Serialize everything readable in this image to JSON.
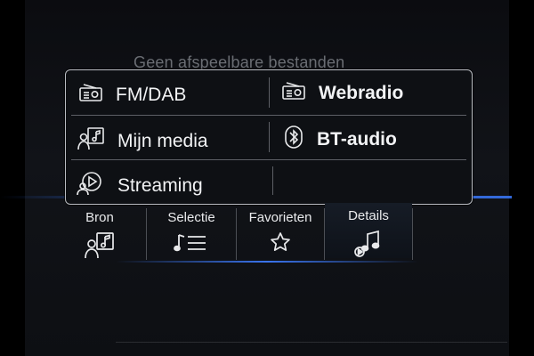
{
  "background_text": "Geen afspeelbare bestanden",
  "source_menu": {
    "items": [
      {
        "label": "FM/DAB",
        "icon": "radio-icon"
      },
      {
        "label": "Webradio",
        "icon": "webradio-icon"
      },
      {
        "label": "Mijn media",
        "icon": "my-media-icon"
      },
      {
        "label": "BT-audio",
        "icon": "bluetooth-icon"
      },
      {
        "label": "Streaming",
        "icon": "streaming-icon"
      },
      {
        "label": "",
        "icon": ""
      }
    ]
  },
  "tabs": [
    {
      "label": "Bron",
      "icon": "source-icon",
      "active": false
    },
    {
      "label": "Selectie",
      "icon": "playlist-icon",
      "active": false
    },
    {
      "label": "Favorieten",
      "icon": "star-icon",
      "active": false
    },
    {
      "label": "Details",
      "icon": "music-details-icon",
      "active": true
    }
  ],
  "colors": {
    "accent": "#3b7bff",
    "text": "#f2f3f5",
    "border": "#b9bcc2"
  }
}
